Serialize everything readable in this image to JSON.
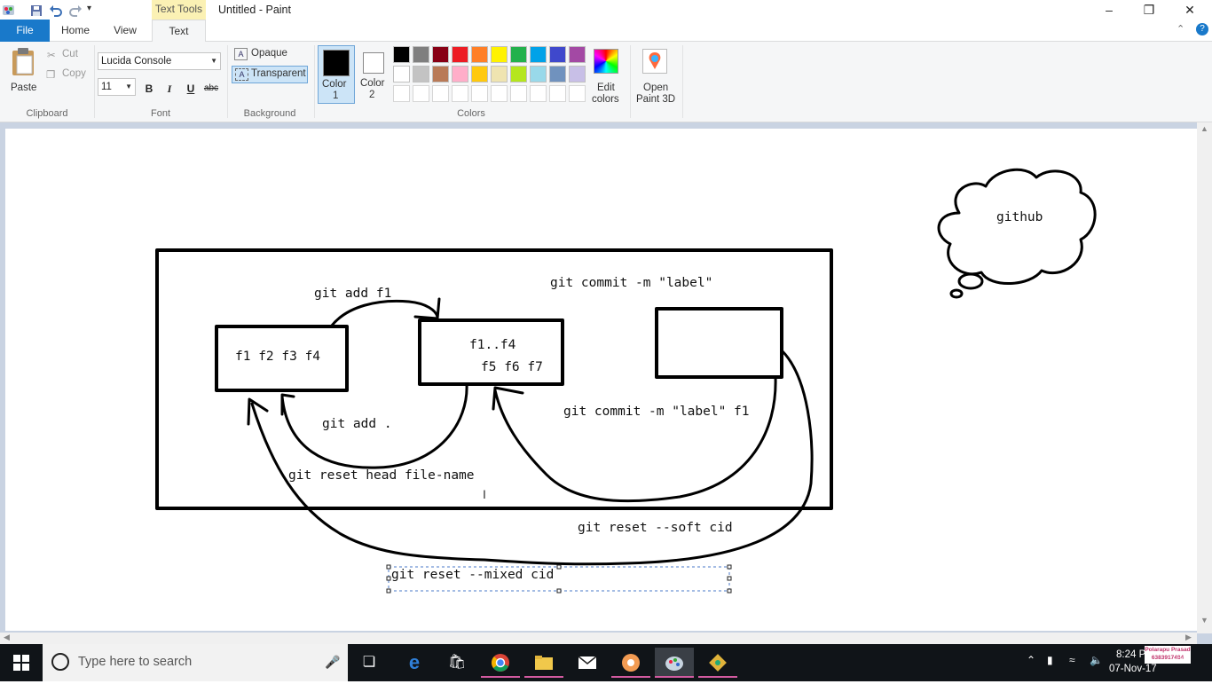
{
  "window": {
    "title": "Untitled - Paint",
    "contextual_tab": "Text Tools"
  },
  "tabs": [
    {
      "label": "File"
    },
    {
      "label": "Home"
    },
    {
      "label": "View"
    },
    {
      "label": "Text"
    }
  ],
  "ribbon": {
    "clipboard": {
      "paste": "Paste",
      "cut": "Cut",
      "copy": "Copy",
      "label": "Clipboard"
    },
    "font": {
      "family": "Lucida Console",
      "size": "11",
      "bold": "B",
      "italic": "I",
      "underline": "U",
      "strike": "abc",
      "label": "Font"
    },
    "background": {
      "opaque": "Opaque",
      "transparent": "Transparent",
      "label": "Background"
    },
    "color1": {
      "line1": "Color",
      "line2": "1",
      "value": "#000000"
    },
    "color2": {
      "line1": "Color",
      "line2": "2",
      "value": "#ffffff"
    },
    "colors_label": "Colors",
    "palette_row1": [
      "#000000",
      "#7f7f7f",
      "#880015",
      "#ed1c24",
      "#ff7f27",
      "#fff200",
      "#22b14c",
      "#00a2e8",
      "#3f48cc",
      "#a349a4"
    ],
    "palette_row2": [
      "#ffffff",
      "#c3c3c3",
      "#b97a57",
      "#ffaec9",
      "#ffc90e",
      "#efe4b0",
      "#b5e61d",
      "#99d9ea",
      "#7092be",
      "#c8bfe7"
    ],
    "edit_colors": {
      "line1": "Edit",
      "line2": "colors"
    },
    "paint3d": {
      "line1": "Open",
      "line2": "Paint 3D"
    }
  },
  "diagram": {
    "cloud_label": "github",
    "git_add_f1": "git add f1",
    "git_commit_label": "git commit -m \"label\"",
    "box1": "f1  f2 f3 f4",
    "box2_line1": "f1..f4",
    "box2_line2": "f5 f6 f7",
    "git_add_dot": "git add .",
    "git_commit_label_f1": "git commit -m \"label\" f1",
    "git_reset_head": "git reset head file-name",
    "git_reset_soft": "git reset --soft cid",
    "git_reset_mixed": "git reset --mixed cid"
  },
  "taskbar": {
    "search_placeholder": "Type here to search",
    "time": "8:24 P",
    "date": "07-Nov-17",
    "watermark_line1": "Polarapu Prasad",
    "watermark_line2": "6383917484"
  }
}
